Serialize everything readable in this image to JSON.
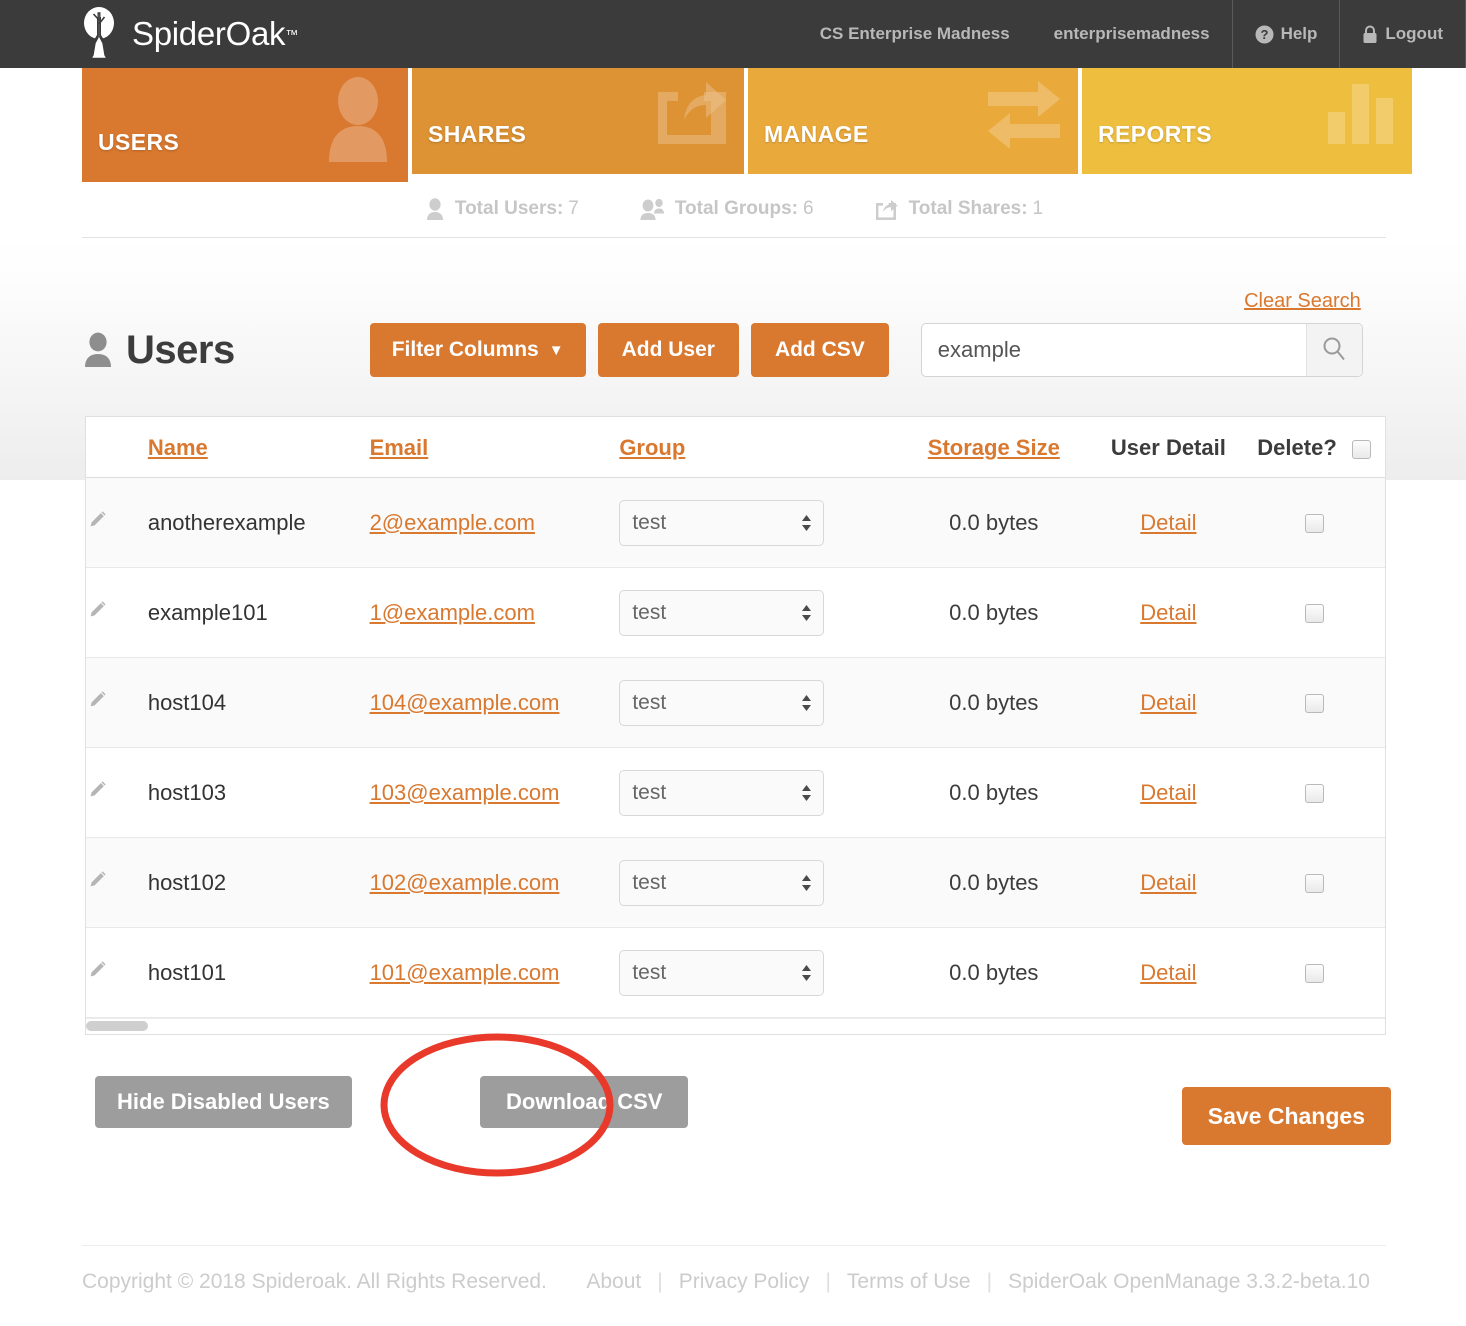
{
  "brand": {
    "name": "SpiderOak",
    "tm": "™",
    "logo_icon": "spideroak-tree-icon"
  },
  "topnav": {
    "org_name": "CS Enterprise Madness",
    "username": "enterprisemadness",
    "help_label": "Help",
    "help_icon": "question-circle-icon",
    "logout_label": "Logout",
    "logout_icon": "lock-icon"
  },
  "tabs": [
    {
      "label": "USERS",
      "icon": "user-icon",
      "color": "#d9782f",
      "active": true
    },
    {
      "label": "SHARES",
      "icon": "share-icon",
      "color": "#dd9233",
      "active": false
    },
    {
      "label": "MANAGE",
      "icon": "exchange-icon",
      "color": "#eaa93b",
      "active": false
    },
    {
      "label": "REPORTS",
      "icon": "bar-chart-icon",
      "color": "#eebe3f",
      "active": false
    }
  ],
  "stats": [
    {
      "icon": "user-icon",
      "label": "Total Users:",
      "value": "7"
    },
    {
      "icon": "users-icon",
      "label": "Total Groups:",
      "value": "6"
    },
    {
      "icon": "share-icon",
      "label": "Total Shares:",
      "value": "1"
    }
  ],
  "header": {
    "title": "Users",
    "title_icon": "user-icon",
    "filter_columns_label": "Filter Columns",
    "filter_caret_icon": "caret-down-icon",
    "add_user_label": "Add User",
    "add_csv_label": "Add CSV",
    "clear_search_label": "Clear Search",
    "search_value": "example",
    "search_placeholder": "Search",
    "search_icon": "search-icon"
  },
  "table": {
    "columns": [
      {
        "key": "edit",
        "label": "",
        "sortable": false
      },
      {
        "key": "name",
        "label": "Name",
        "sortable": true
      },
      {
        "key": "email",
        "label": "Email",
        "sortable": true
      },
      {
        "key": "group",
        "label": "Group",
        "sortable": true
      },
      {
        "key": "size",
        "label": "Storage Size",
        "sortable": true
      },
      {
        "key": "detail",
        "label": "User Detail",
        "sortable": false
      },
      {
        "key": "delete",
        "label": "Delete?",
        "sortable": false
      }
    ],
    "select_all_checked": false,
    "detail_link_label": "Detail",
    "edit_icon": "pencil-icon",
    "rows": [
      {
        "name": "anotherexample",
        "email": "2@example.com",
        "group": "test",
        "size": "0.0 bytes",
        "detail": "Detail",
        "delete_checked": false
      },
      {
        "name": "example101",
        "email": "1@example.com",
        "group": "test",
        "size": "0.0 bytes",
        "detail": "Detail",
        "delete_checked": false
      },
      {
        "name": "host104",
        "email": "104@example.com",
        "group": "test",
        "size": "0.0 bytes",
        "detail": "Detail",
        "delete_checked": false
      },
      {
        "name": "host103",
        "email": "103@example.com",
        "group": "test",
        "size": "0.0 bytes",
        "detail": "Detail",
        "delete_checked": false
      },
      {
        "name": "host102",
        "email": "102@example.com",
        "group": "test",
        "size": "0.0 bytes",
        "detail": "Detail",
        "delete_checked": false
      },
      {
        "name": "host101",
        "email": "101@example.com",
        "group": "test",
        "size": "0.0 bytes",
        "detail": "Detail",
        "delete_checked": false
      }
    ]
  },
  "actions": {
    "hide_disabled_label": "Hide Disabled Users",
    "download_csv_label": "Download CSV",
    "save_changes_label": "Save Changes",
    "annotation": {
      "shape": "ellipse",
      "color": "#e8392a",
      "target": "download-csv-button"
    }
  },
  "footer": {
    "copyright": "Copyright © 2018 Spideroak. All Rights Reserved.",
    "links": [
      "About",
      "Privacy Policy",
      "Terms of Use"
    ],
    "version": "SpiderOak OpenManage 3.3.2-beta.10"
  },
  "colors": {
    "brand_orange": "#d9782f",
    "dark_bar": "#3b3b3b",
    "annotation_red": "#e8392a"
  }
}
